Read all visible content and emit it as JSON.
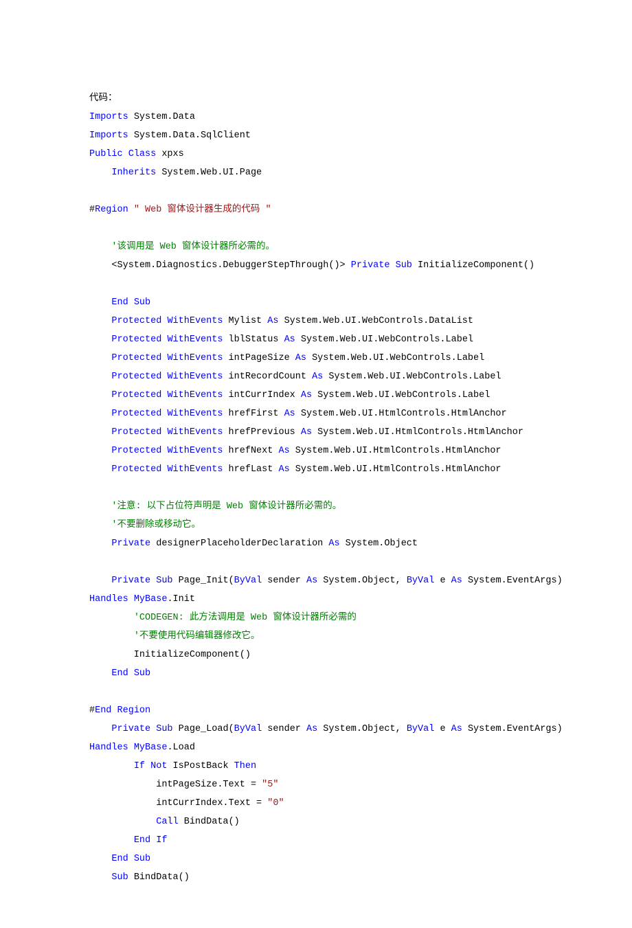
{
  "title": "代码：",
  "code": {
    "tokens": [
      [
        {
          "t": "代码：",
          "c": ""
        }
      ],
      [
        {
          "t": "Imports",
          "c": "kw"
        },
        {
          "t": " System.Data",
          "c": ""
        }
      ],
      [
        {
          "t": "Imports",
          "c": "kw"
        },
        {
          "t": " System.Data.SqlClient",
          "c": ""
        }
      ],
      [
        {
          "t": "Public",
          "c": "kw"
        },
        {
          "t": " ",
          "c": ""
        },
        {
          "t": "Class",
          "c": "kw"
        },
        {
          "t": " xpxs",
          "c": ""
        }
      ],
      [
        {
          "t": "    ",
          "c": ""
        },
        {
          "t": "Inherits",
          "c": "kw"
        },
        {
          "t": " System.Web.UI.Page",
          "c": ""
        }
      ],
      [
        {
          "t": " ",
          "c": ""
        }
      ],
      [
        {
          "t": "#",
          "c": ""
        },
        {
          "t": "Region",
          "c": "kw"
        },
        {
          "t": " ",
          "c": ""
        },
        {
          "t": "\" Web 窗体设计器生成的代码 \"",
          "c": "str"
        }
      ],
      [
        {
          "t": " ",
          "c": ""
        }
      ],
      [
        {
          "t": "    ",
          "c": ""
        },
        {
          "t": "'该调用是 Web 窗体设计器所必需的。",
          "c": "cm"
        }
      ],
      [
        {
          "t": "    <System.Diagnostics.DebuggerStepThrough()> ",
          "c": ""
        },
        {
          "t": "Private",
          "c": "kw"
        },
        {
          "t": " ",
          "c": ""
        },
        {
          "t": "Sub",
          "c": "kw"
        },
        {
          "t": " InitializeComponent()",
          "c": ""
        }
      ],
      [
        {
          "t": " ",
          "c": ""
        }
      ],
      [
        {
          "t": "    ",
          "c": ""
        },
        {
          "t": "End",
          "c": "kw"
        },
        {
          "t": " ",
          "c": ""
        },
        {
          "t": "Sub",
          "c": "kw"
        }
      ],
      [
        {
          "t": "    ",
          "c": ""
        },
        {
          "t": "Protected",
          "c": "kw"
        },
        {
          "t": " ",
          "c": ""
        },
        {
          "t": "WithEvents",
          "c": "kw"
        },
        {
          "t": " Mylist ",
          "c": ""
        },
        {
          "t": "As",
          "c": "kw"
        },
        {
          "t": " System.Web.UI.WebControls.DataList",
          "c": ""
        }
      ],
      [
        {
          "t": "    ",
          "c": ""
        },
        {
          "t": "Protected",
          "c": "kw"
        },
        {
          "t": " ",
          "c": ""
        },
        {
          "t": "WithEvents",
          "c": "kw"
        },
        {
          "t": " lblStatus ",
          "c": ""
        },
        {
          "t": "As",
          "c": "kw"
        },
        {
          "t": " System.Web.UI.WebControls.Label",
          "c": ""
        }
      ],
      [
        {
          "t": "    ",
          "c": ""
        },
        {
          "t": "Protected",
          "c": "kw"
        },
        {
          "t": " ",
          "c": ""
        },
        {
          "t": "WithEvents",
          "c": "kw"
        },
        {
          "t": " intPageSize ",
          "c": ""
        },
        {
          "t": "As",
          "c": "kw"
        },
        {
          "t": " System.Web.UI.WebControls.Label",
          "c": ""
        }
      ],
      [
        {
          "t": "    ",
          "c": ""
        },
        {
          "t": "Protected",
          "c": "kw"
        },
        {
          "t": " ",
          "c": ""
        },
        {
          "t": "WithEvents",
          "c": "kw"
        },
        {
          "t": " intRecordCount ",
          "c": ""
        },
        {
          "t": "As",
          "c": "kw"
        },
        {
          "t": " System.Web.UI.WebControls.Label",
          "c": ""
        }
      ],
      [
        {
          "t": "    ",
          "c": ""
        },
        {
          "t": "Protected",
          "c": "kw"
        },
        {
          "t": " ",
          "c": ""
        },
        {
          "t": "WithEvents",
          "c": "kw"
        },
        {
          "t": " intCurrIndex ",
          "c": ""
        },
        {
          "t": "As",
          "c": "kw"
        },
        {
          "t": " System.Web.UI.WebControls.Label",
          "c": ""
        }
      ],
      [
        {
          "t": "    ",
          "c": ""
        },
        {
          "t": "Protected",
          "c": "kw"
        },
        {
          "t": " ",
          "c": ""
        },
        {
          "t": "WithEvents",
          "c": "kw"
        },
        {
          "t": " hrefFirst ",
          "c": ""
        },
        {
          "t": "As",
          "c": "kw"
        },
        {
          "t": " System.Web.UI.HtmlControls.HtmlAnchor",
          "c": ""
        }
      ],
      [
        {
          "t": "    ",
          "c": ""
        },
        {
          "t": "Protected",
          "c": "kw"
        },
        {
          "t": " ",
          "c": ""
        },
        {
          "t": "WithEvents",
          "c": "kw"
        },
        {
          "t": " hrefPrevious ",
          "c": ""
        },
        {
          "t": "As",
          "c": "kw"
        },
        {
          "t": " System.Web.UI.HtmlControls.HtmlAnchor",
          "c": ""
        }
      ],
      [
        {
          "t": "    ",
          "c": ""
        },
        {
          "t": "Protected",
          "c": "kw"
        },
        {
          "t": " ",
          "c": ""
        },
        {
          "t": "WithEvents",
          "c": "kw"
        },
        {
          "t": " hrefNext ",
          "c": ""
        },
        {
          "t": "As",
          "c": "kw"
        },
        {
          "t": " System.Web.UI.HtmlControls.HtmlAnchor",
          "c": ""
        }
      ],
      [
        {
          "t": "    ",
          "c": ""
        },
        {
          "t": "Protected",
          "c": "kw"
        },
        {
          "t": " ",
          "c": ""
        },
        {
          "t": "WithEvents",
          "c": "kw"
        },
        {
          "t": " hrefLast ",
          "c": ""
        },
        {
          "t": "As",
          "c": "kw"
        },
        {
          "t": " System.Web.UI.HtmlControls.HtmlAnchor",
          "c": ""
        }
      ],
      [
        {
          "t": " ",
          "c": ""
        }
      ],
      [
        {
          "t": "    ",
          "c": ""
        },
        {
          "t": "'注意: 以下占位符声明是 Web 窗体设计器所必需的。",
          "c": "cm"
        }
      ],
      [
        {
          "t": "    ",
          "c": ""
        },
        {
          "t": "'不要删除或移动它。",
          "c": "cm"
        }
      ],
      [
        {
          "t": "    ",
          "c": ""
        },
        {
          "t": "Private",
          "c": "kw"
        },
        {
          "t": " designerPlaceholderDeclaration ",
          "c": ""
        },
        {
          "t": "As",
          "c": "kw"
        },
        {
          "t": " System.Object",
          "c": ""
        }
      ],
      [
        {
          "t": " ",
          "c": ""
        }
      ],
      [
        {
          "t": "    ",
          "c": ""
        },
        {
          "t": "Private",
          "c": "kw"
        },
        {
          "t": " ",
          "c": ""
        },
        {
          "t": "Sub",
          "c": "kw"
        },
        {
          "t": " Page_Init(",
          "c": ""
        },
        {
          "t": "ByVal",
          "c": "kw"
        },
        {
          "t": " sender ",
          "c": ""
        },
        {
          "t": "As",
          "c": "kw"
        },
        {
          "t": " System.Object, ",
          "c": ""
        },
        {
          "t": "ByVal",
          "c": "kw"
        },
        {
          "t": " e ",
          "c": ""
        },
        {
          "t": "As",
          "c": "kw"
        },
        {
          "t": " System.EventArgs) ",
          "c": ""
        }
      ],
      [
        {
          "t": "Handles",
          "c": "kw"
        },
        {
          "t": " ",
          "c": ""
        },
        {
          "t": "MyBase",
          "c": "kw"
        },
        {
          "t": ".Init",
          "c": ""
        }
      ],
      [
        {
          "t": "        ",
          "c": ""
        },
        {
          "t": "'CODEGEN: 此方法调用是 Web 窗体设计器所必需的",
          "c": "cm"
        }
      ],
      [
        {
          "t": "        ",
          "c": ""
        },
        {
          "t": "'不要使用代码编辑器修改它。",
          "c": "cm"
        }
      ],
      [
        {
          "t": "        InitializeComponent()",
          "c": ""
        }
      ],
      [
        {
          "t": "    ",
          "c": ""
        },
        {
          "t": "End",
          "c": "kw"
        },
        {
          "t": " ",
          "c": ""
        },
        {
          "t": "Sub",
          "c": "kw"
        }
      ],
      [
        {
          "t": " ",
          "c": ""
        }
      ],
      [
        {
          "t": "#",
          "c": ""
        },
        {
          "t": "End",
          "c": "kw"
        },
        {
          "t": " ",
          "c": ""
        },
        {
          "t": "Region",
          "c": "kw"
        }
      ],
      [
        {
          "t": "    ",
          "c": ""
        },
        {
          "t": "Private",
          "c": "kw"
        },
        {
          "t": " ",
          "c": ""
        },
        {
          "t": "Sub",
          "c": "kw"
        },
        {
          "t": " Page_Load(",
          "c": ""
        },
        {
          "t": "ByVal",
          "c": "kw"
        },
        {
          "t": " sender ",
          "c": ""
        },
        {
          "t": "As",
          "c": "kw"
        },
        {
          "t": " System.Object, ",
          "c": ""
        },
        {
          "t": "ByVal",
          "c": "kw"
        },
        {
          "t": " e ",
          "c": ""
        },
        {
          "t": "As",
          "c": "kw"
        },
        {
          "t": " System.EventArgs) ",
          "c": ""
        }
      ],
      [
        {
          "t": "Handles",
          "c": "kw"
        },
        {
          "t": " ",
          "c": ""
        },
        {
          "t": "MyBase",
          "c": "kw"
        },
        {
          "t": ".Load",
          "c": ""
        }
      ],
      [
        {
          "t": "        ",
          "c": ""
        },
        {
          "t": "If",
          "c": "kw"
        },
        {
          "t": " ",
          "c": ""
        },
        {
          "t": "Not",
          "c": "kw"
        },
        {
          "t": " IsPostBack ",
          "c": ""
        },
        {
          "t": "Then",
          "c": "kw"
        }
      ],
      [
        {
          "t": "            intPageSize.Text = ",
          "c": ""
        },
        {
          "t": "\"5\"",
          "c": "str"
        }
      ],
      [
        {
          "t": "            intCurrIndex.Text = ",
          "c": ""
        },
        {
          "t": "\"0\"",
          "c": "str"
        }
      ],
      [
        {
          "t": "            ",
          "c": ""
        },
        {
          "t": "Call",
          "c": "kw"
        },
        {
          "t": " BindData()",
          "c": ""
        }
      ],
      [
        {
          "t": "        ",
          "c": ""
        },
        {
          "t": "End",
          "c": "kw"
        },
        {
          "t": " ",
          "c": ""
        },
        {
          "t": "If",
          "c": "kw"
        }
      ],
      [
        {
          "t": "    ",
          "c": ""
        },
        {
          "t": "End",
          "c": "kw"
        },
        {
          "t": " ",
          "c": ""
        },
        {
          "t": "Sub",
          "c": "kw"
        }
      ],
      [
        {
          "t": "    ",
          "c": ""
        },
        {
          "t": "Sub",
          "c": "kw"
        },
        {
          "t": " BindData()",
          "c": ""
        }
      ]
    ]
  }
}
